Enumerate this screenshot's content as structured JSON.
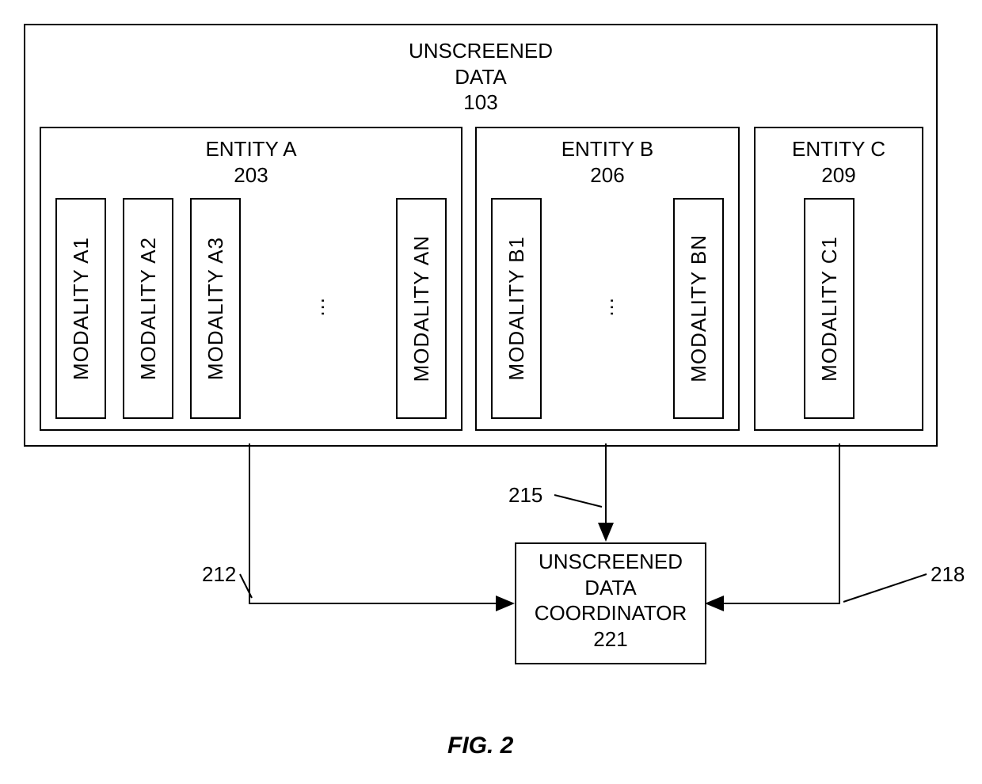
{
  "outer": {
    "title_line1": "UNSCREENED",
    "title_line2": "DATA",
    "number": "103"
  },
  "entityA": {
    "title": "ENTITY A",
    "number": "203",
    "modalities": [
      "MODALITY A1",
      "MODALITY A2",
      "MODALITY A3",
      "MODALITY AN"
    ],
    "ellipsis": "..."
  },
  "entityB": {
    "title": "ENTITY B",
    "number": "206",
    "modalities": [
      "MODALITY B1",
      "MODALITY BN"
    ],
    "ellipsis": "..."
  },
  "entityC": {
    "title": "ENTITY C",
    "number": "209",
    "modalities": [
      "MODALITY C1"
    ]
  },
  "coordinator": {
    "line1": "UNSCREENED",
    "line2": "DATA",
    "line3": "COORDINATOR",
    "number": "221"
  },
  "arrow_labels": {
    "a": "212",
    "b": "215",
    "c": "218"
  },
  "caption": "FIG. 2"
}
